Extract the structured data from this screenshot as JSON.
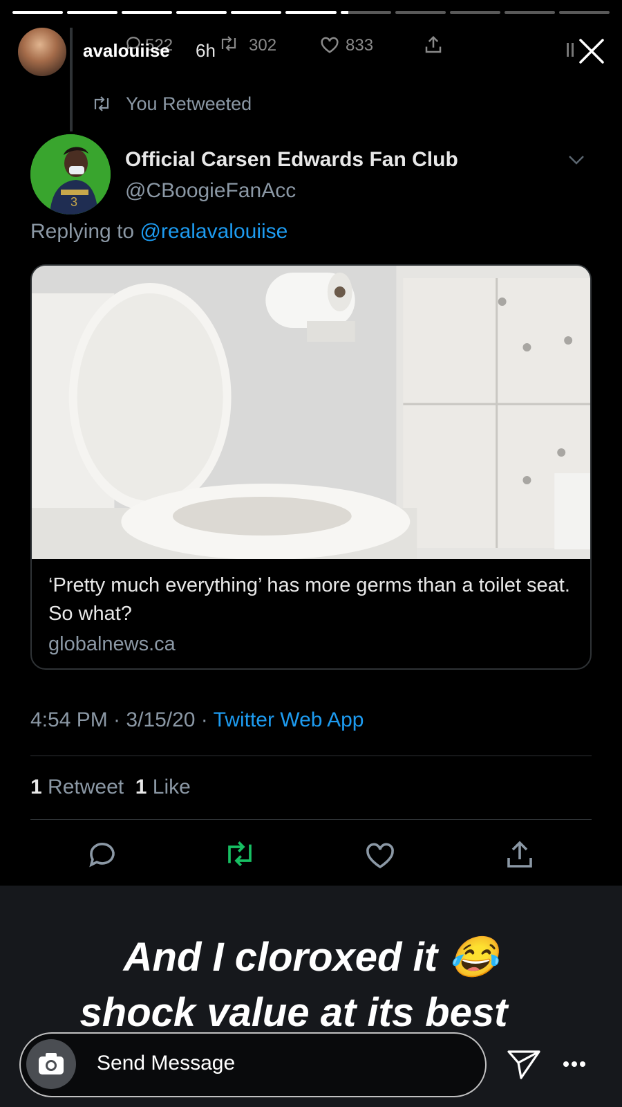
{
  "story": {
    "progress": [
      1,
      1,
      1,
      1,
      1,
      1,
      0.15,
      0,
      0,
      0,
      0
    ],
    "username": "avalouiise",
    "time_ago": "6h"
  },
  "background_tweet": {
    "reply_count": "522",
    "retweet_count": "302",
    "like_count": "833"
  },
  "tweet": {
    "retweet_label": "You Retweeted",
    "author_name": "Official Carsen Edwards Fan Club",
    "author_handle": "@CBoogieFanAcc",
    "replying_prefix": "Replying to",
    "replying_mention": "@realavalouiise",
    "card_title": "‘Pretty much everything’ has more germs than a toilet seat. So what?",
    "card_domain": "globalnews.ca",
    "timestamp": "4:54 PM · 3/15/20 · ",
    "source": "Twitter Web App",
    "retweet_count_num": "1",
    "retweet_count_label": "Retweet",
    "like_count_num": "1",
    "like_count_label": "Like"
  },
  "caption": {
    "line1": "And I cloroxed it 😂",
    "line2": "shock value at its best"
  },
  "message_bar": {
    "placeholder": "Send Message"
  },
  "colors": {
    "background": "#000000",
    "link_blue": "#1d9bf0",
    "retweet_green": "#17bf63",
    "muted_gray": "#8b98a5",
    "divider": "#2f3336"
  },
  "icons": {
    "close": "close-icon",
    "retweet": "retweet-icon",
    "reply": "reply-icon",
    "like": "heart-icon",
    "share": "share-icon",
    "camera": "camera-icon",
    "send": "send-icon",
    "more": "more-icon",
    "chevron": "chevron-down-icon"
  }
}
